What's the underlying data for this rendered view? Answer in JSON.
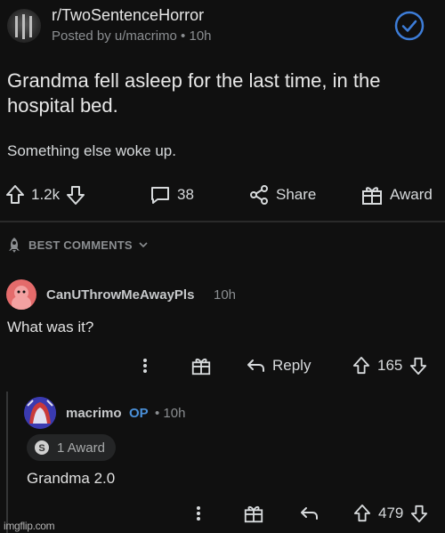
{
  "post": {
    "subreddit": "r/TwoSentenceHorror",
    "meta": "Posted by u/macrimo • 10h",
    "title": "Grandma fell asleep for the last time, in the hospital bed.",
    "body": "Something else woke up.",
    "votes": "1.2k",
    "comments": "38",
    "share_label": "Share",
    "award_label": "Award"
  },
  "sort": {
    "label": "BEST COMMENTS"
  },
  "comment": {
    "author": "CanUThrowMeAwayPls",
    "time": "10h",
    "text": "What was it?",
    "reply_label": "Reply",
    "votes": "165"
  },
  "reply": {
    "author": "macrimo",
    "op_badge": "OP",
    "time": "• 10h",
    "award_chip": "1 Award",
    "text": "Grandma 2.0",
    "votes": "479"
  },
  "watermark": "imgflip.com",
  "colors": {
    "background": "#101010",
    "text": "#d7dadc",
    "muted": "#8b8e91",
    "op_blue": "#4a90d9",
    "verified_blue": "#3d7dd8",
    "avatar_pink": "#e46b6b"
  }
}
